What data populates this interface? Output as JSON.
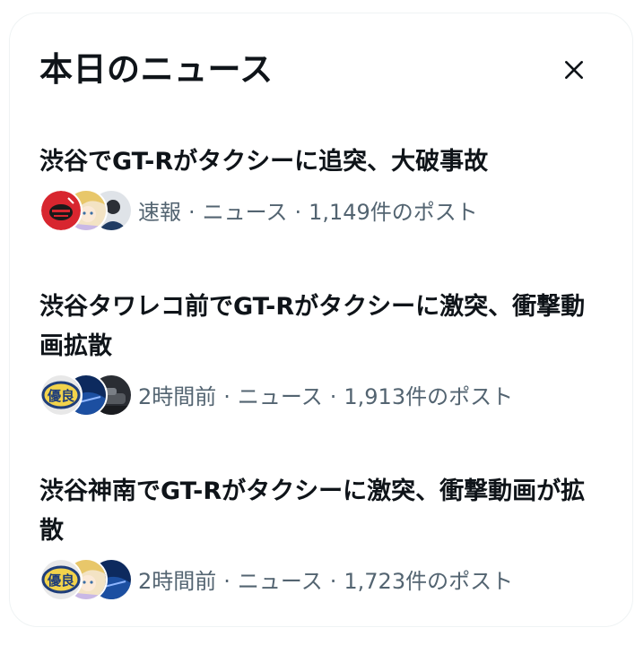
{
  "panel": {
    "title": "本日のニュース",
    "close_icon": "close-icon"
  },
  "items": [
    {
      "headline": "渋谷でGT-Rがタクシーに追突、大破事故",
      "time": "速報",
      "category": "ニュース",
      "posts": "1,149件のポスト",
      "avatars": [
        "red-emblem-avatar",
        "anime-character-avatar",
        "person-avatar"
      ]
    },
    {
      "headline": "渋谷タワレコ前でGT-Rがタクシーに激突、衝撃動画拡散",
      "time": "2時間前",
      "category": "ニュース",
      "posts": "1,913件のポスト",
      "avatars": [
        "yuryo-badge-avatar",
        "blue-car-avatar",
        "dark-car-avatar"
      ]
    },
    {
      "headline": "渋谷神南でGT-Rがタクシーに激突、衝撃動画が拡散",
      "time": "2時間前",
      "category": "ニュース",
      "posts": "1,723件のポスト",
      "avatars": [
        "yuryo-badge-avatar",
        "anime-character-avatar",
        "blue-car-avatar"
      ]
    }
  ],
  "badge_text": "優良",
  "colors": {
    "text": "#0f1419",
    "secondary": "#536471",
    "border": "#eff3f4"
  }
}
